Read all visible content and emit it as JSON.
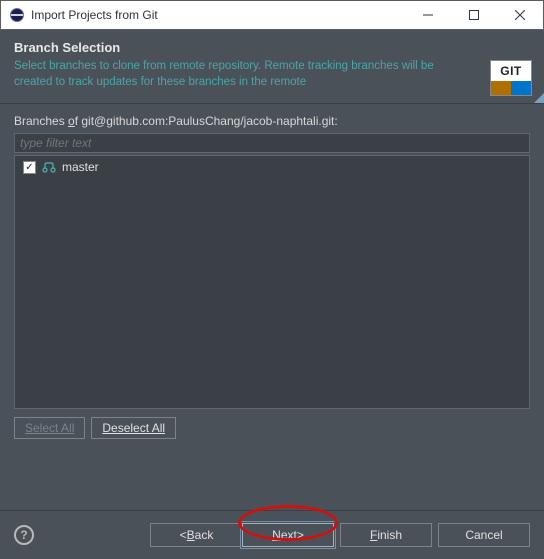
{
  "titlebar": {
    "title": "Import Projects from Git"
  },
  "header": {
    "heading": "Branch Selection",
    "desc": "Select branches to clone from remote repository. Remote tracking branches will be created to track updates for these branches in the remote"
  },
  "git_badge": "GIT",
  "body": {
    "label_prefix": "Branches ",
    "label_u": "o",
    "label_suffix": "f git@github.com:PaulusChang/jacob-naphtali.git:",
    "filter_placeholder": "type filter text",
    "branches": [
      {
        "name": "master",
        "checked": true
      }
    ],
    "select_all": "Select All",
    "deselect_all": "Deselect All"
  },
  "footer": {
    "back_lt": "< ",
    "back_u": "B",
    "back_rest": "ack",
    "next_u": "N",
    "next_rest": "ext ",
    "next_gt": ">",
    "finish_u": "F",
    "finish_rest": "inish",
    "cancel": "Cancel"
  }
}
